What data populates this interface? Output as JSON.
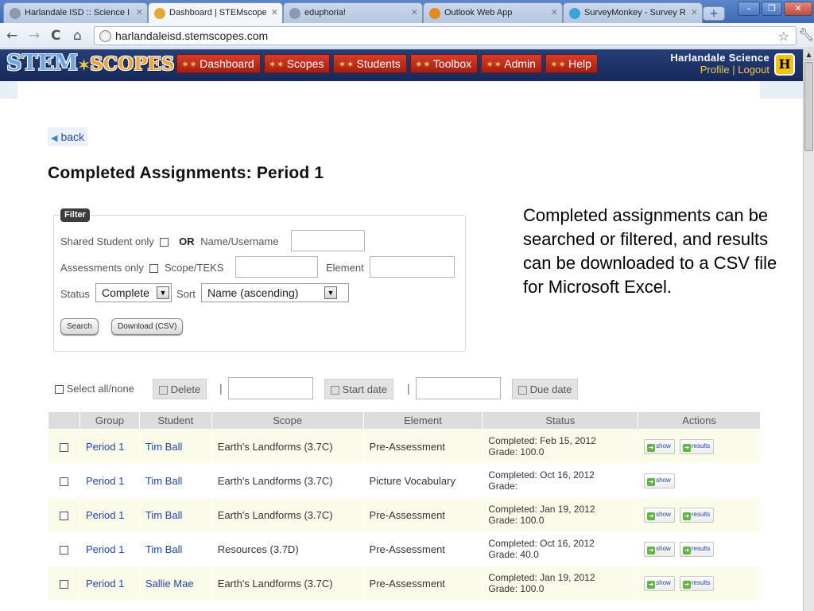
{
  "browser": {
    "tabs": [
      {
        "title": "Harlandale ISD :: Science I",
        "icon_color": "#8a9bb0",
        "active": false
      },
      {
        "title": "Dashboard | STEMscopes",
        "icon_color": "#e6a832",
        "active": true
      },
      {
        "title": "eduphoria!",
        "icon_color": "#8a9bb0",
        "active": false
      },
      {
        "title": "Outlook Web App",
        "icon_color": "#e5891a",
        "active": false
      },
      {
        "title": "SurveyMonkey - Survey R",
        "icon_color": "#3aa3d8",
        "active": false
      }
    ],
    "url": "harlandaleisd.stemscopes.com"
  },
  "site": {
    "logo_part1": "STEM",
    "logo_part2": "SCOPES",
    "nav": [
      "Dashboard",
      "Scopes",
      "Students",
      "Toolbox",
      "Admin",
      "Help"
    ],
    "user_name": "Harlandale Science",
    "profile_label": "Profile",
    "link_separator": " | ",
    "logout_label": "Logout",
    "badge_letter": "H"
  },
  "page": {
    "back_label": "back",
    "title": "Completed Assignments: Period 1"
  },
  "filter": {
    "legend": "Filter",
    "shared_student_label": "Shared Student only",
    "or_label": "OR",
    "name_label": "Name/Username",
    "assessments_label": "Assessments only",
    "scope_label": "Scope/TEKS",
    "element_label": "Element",
    "status_label": "Status",
    "status_value": "Complete",
    "sort_label": "Sort",
    "sort_value": "Name (ascending)",
    "search_button": "Search",
    "download_button": "Download (CSV)"
  },
  "note": "Completed assignments can be searched or filtered, and results can be downloaded to a CSV file for Microsoft Excel.",
  "bulk": {
    "select_all_label": "Select all/none",
    "delete_label": "Delete",
    "start_date_label": "Start date",
    "due_date_label": "Due date",
    "separator": "|"
  },
  "table": {
    "headers": [
      "Group",
      "Student",
      "Scope",
      "Element",
      "Status",
      "Actions"
    ],
    "show_label": "show",
    "results_label": "results",
    "rows": [
      {
        "group": "Period 1",
        "student": "Tim Ball",
        "scope": "Earth's Landforms (3.7C)",
        "element": "Pre-Assessment",
        "status_line1": "Completed: Feb 15, 2012",
        "status_line2": "Grade: 100.0",
        "has_results": true
      },
      {
        "group": "Period 1",
        "student": "Tim Ball",
        "scope": "Earth's Landforms (3.7C)",
        "element": "Picture Vocabulary",
        "status_line1": "Completed: Oct 16, 2012",
        "status_line2": "Grade:",
        "has_results": false
      },
      {
        "group": "Period 1",
        "student": "Tim Ball",
        "scope": "Earth's Landforms (3.7C)",
        "element": "Pre-Assessment",
        "status_line1": "Completed: Jan 19, 2012",
        "status_line2": "Grade: 100.0",
        "has_results": true
      },
      {
        "group": "Period 1",
        "student": "Tim Ball",
        "scope": "Resources (3.7D)",
        "element": "Pre-Assessment",
        "status_line1": "Completed: Oct 16, 2012",
        "status_line2": "Grade: 40.0",
        "has_results": true
      },
      {
        "group": "Period 1",
        "student": "Sallie Mae",
        "scope": "Earth's Landforms (3.7C)",
        "element": "Pre-Assessment",
        "status_line1": "Completed: Jan 19, 2012",
        "status_line2": "Grade: 100.0",
        "has_results": true
      }
    ]
  }
}
